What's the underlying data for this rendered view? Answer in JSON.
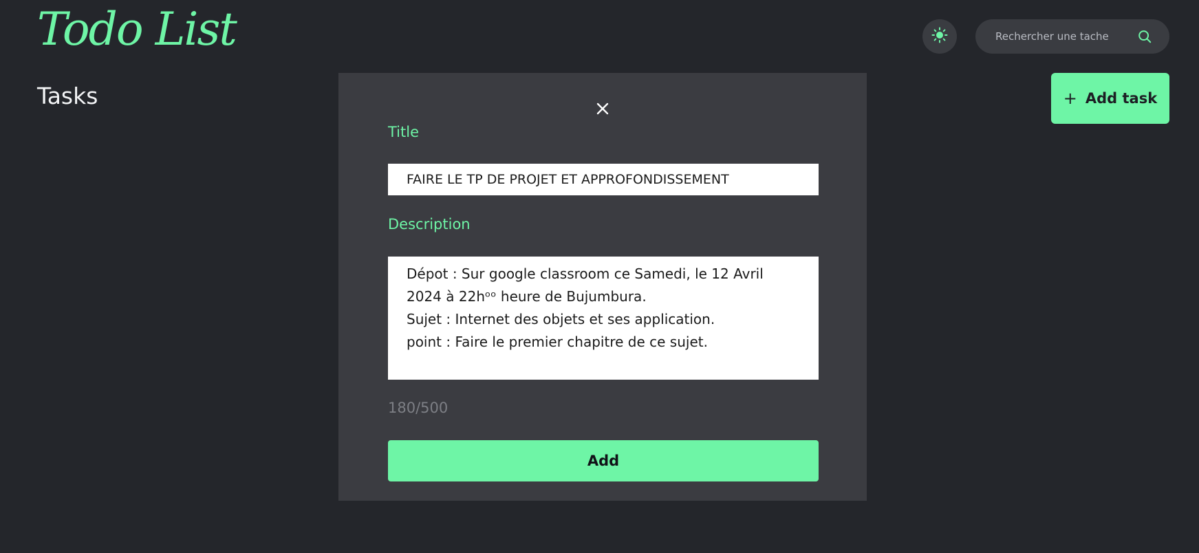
{
  "header": {
    "logo": "Todo List",
    "search_placeholder": "Rechercher une tache"
  },
  "page": {
    "heading": "Tasks",
    "add_task_label": "Add task"
  },
  "modal": {
    "title_label": "Title",
    "title_value": "FAIRE LE TP DE PROJET ET APPROFONDISSEMENT",
    "description_label": "Description",
    "description_value": "Dépot : Sur google classroom ce Samedi, le 12 Avril 2024 à 22hᵒᵒ heure de Bujumbura.\nSujet : Internet des objets et ses application.\npoint : Faire le premier chapitre de ce sujet.",
    "counter": "180/500",
    "add_button": "Add"
  },
  "icons": {
    "theme_toggle": "sun-icon",
    "search": "search-icon",
    "close": "close-icon",
    "add": "plus-icon"
  },
  "colors": {
    "background": "#24262b",
    "surface": "#3b3c41",
    "accent": "#6ef5a6",
    "text": "#f3f4f6"
  }
}
